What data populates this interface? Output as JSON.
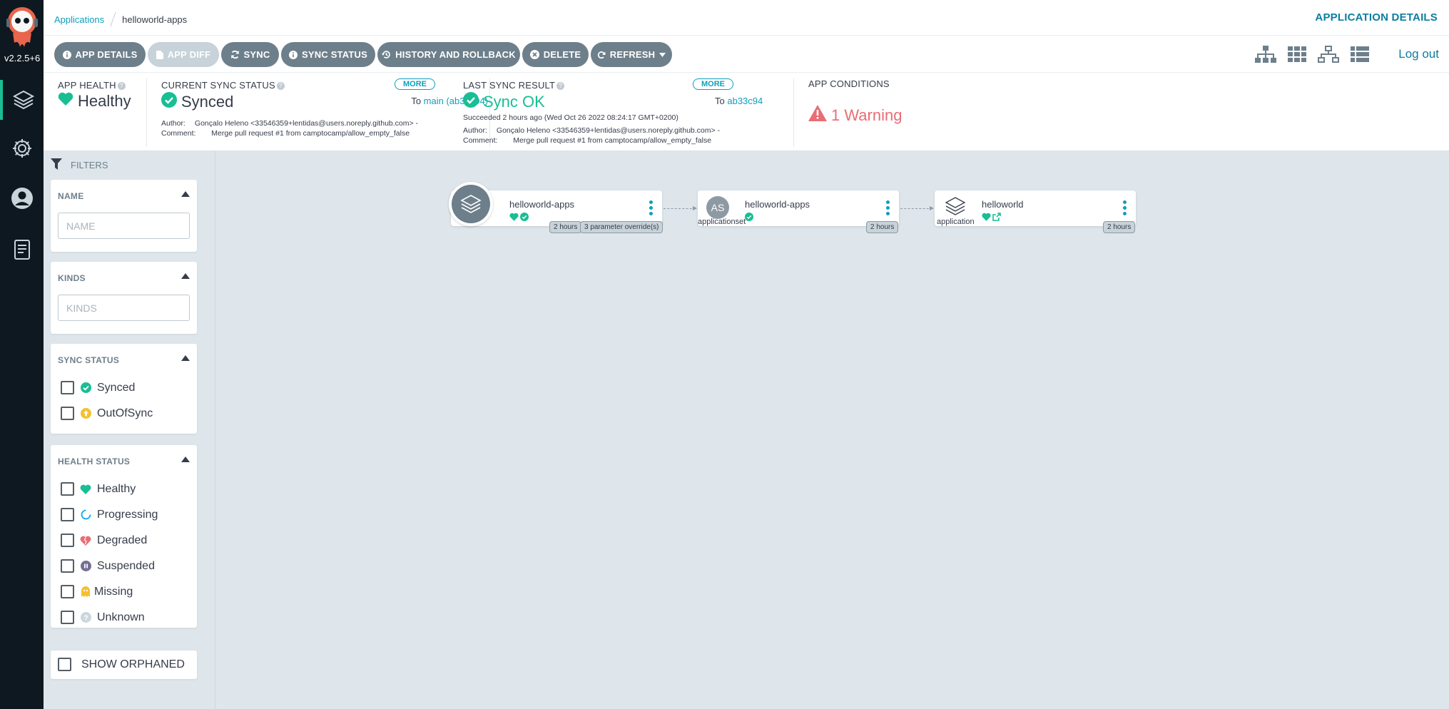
{
  "nav": {
    "version": "v2.2.5+6",
    "items": [
      {
        "name": "applications",
        "icon": "layers-icon"
      },
      {
        "name": "settings",
        "icon": "gear-icon"
      },
      {
        "name": "user-info",
        "icon": "user-icon"
      },
      {
        "name": "documentation",
        "icon": "docs-icon"
      }
    ]
  },
  "header": {
    "breadcrumb_root": "Applications",
    "breadcrumb_current": "helloworld-apps",
    "title": "APPLICATION DETAILS"
  },
  "toolbar": {
    "app_details": "APP DETAILS",
    "app_diff": "APP DIFF",
    "sync": "SYNC",
    "sync_status": "SYNC STATUS",
    "history": "HISTORY AND ROLLBACK",
    "delete": "DELETE",
    "refresh": "REFRESH",
    "logout": "Log out"
  },
  "status": {
    "app_health": {
      "title": "APP HEALTH",
      "value": "Healthy"
    },
    "current_sync": {
      "title": "CURRENT SYNC STATUS",
      "value": "Synced",
      "more": "MORE",
      "to_label": "To",
      "to_ref": "main (ab33c94)",
      "author_label": "Author:",
      "author": "Gonçalo Heleno <33546359+lentidas@users.noreply.github.com> -",
      "comment_label": "Comment:",
      "comment": "Merge pull request #1 from camptocamp/allow_empty_false"
    },
    "last_sync": {
      "title": "LAST SYNC RESULT",
      "value": "Sync OK",
      "more": "MORE",
      "to_label": "To",
      "to_ref": "ab33c94",
      "succeeded": "Succeeded 2 hours ago (Wed Oct 26 2022 08:24:17 GMT+0200)",
      "author_label": "Author:",
      "author": "Gonçalo Heleno <33546359+lentidas@users.noreply.github.com> -",
      "comment_label": "Comment:",
      "comment": "Merge pull request #1 from camptocamp/allow_empty_false"
    },
    "conditions": {
      "title": "APP CONDITIONS",
      "value": "1 Warning"
    }
  },
  "filters": {
    "heading": "FILTERS",
    "name": {
      "title": "NAME",
      "placeholder": "NAME"
    },
    "kinds": {
      "title": "KINDS",
      "placeholder": "KINDS"
    },
    "sync_status": {
      "title": "SYNC STATUS",
      "options": [
        "Synced",
        "OutOfSync"
      ]
    },
    "health_status": {
      "title": "HEALTH STATUS",
      "options": [
        "Healthy",
        "Progressing",
        "Degraded",
        "Suspended",
        "Missing",
        "Unknown"
      ]
    },
    "show_orphaned": "SHOW ORPHANED"
  },
  "graph": {
    "nodes": [
      {
        "name": "helloworld-apps",
        "kind": "",
        "tags": [
          "2 hours",
          "3 parameter override(s)"
        ]
      },
      {
        "name": "helloworld-apps",
        "kind": "applicationset",
        "badge": "AS",
        "tags": [
          "2 hours"
        ]
      },
      {
        "name": "helloworld",
        "kind": "application",
        "tags": [
          "2 hours"
        ]
      }
    ]
  },
  "colors": {
    "accent": "#0f9ebd",
    "healthy": "#18be94",
    "warning": "#e96d76",
    "nav_bg": "#0e1820",
    "button": "#6d7f8b"
  }
}
